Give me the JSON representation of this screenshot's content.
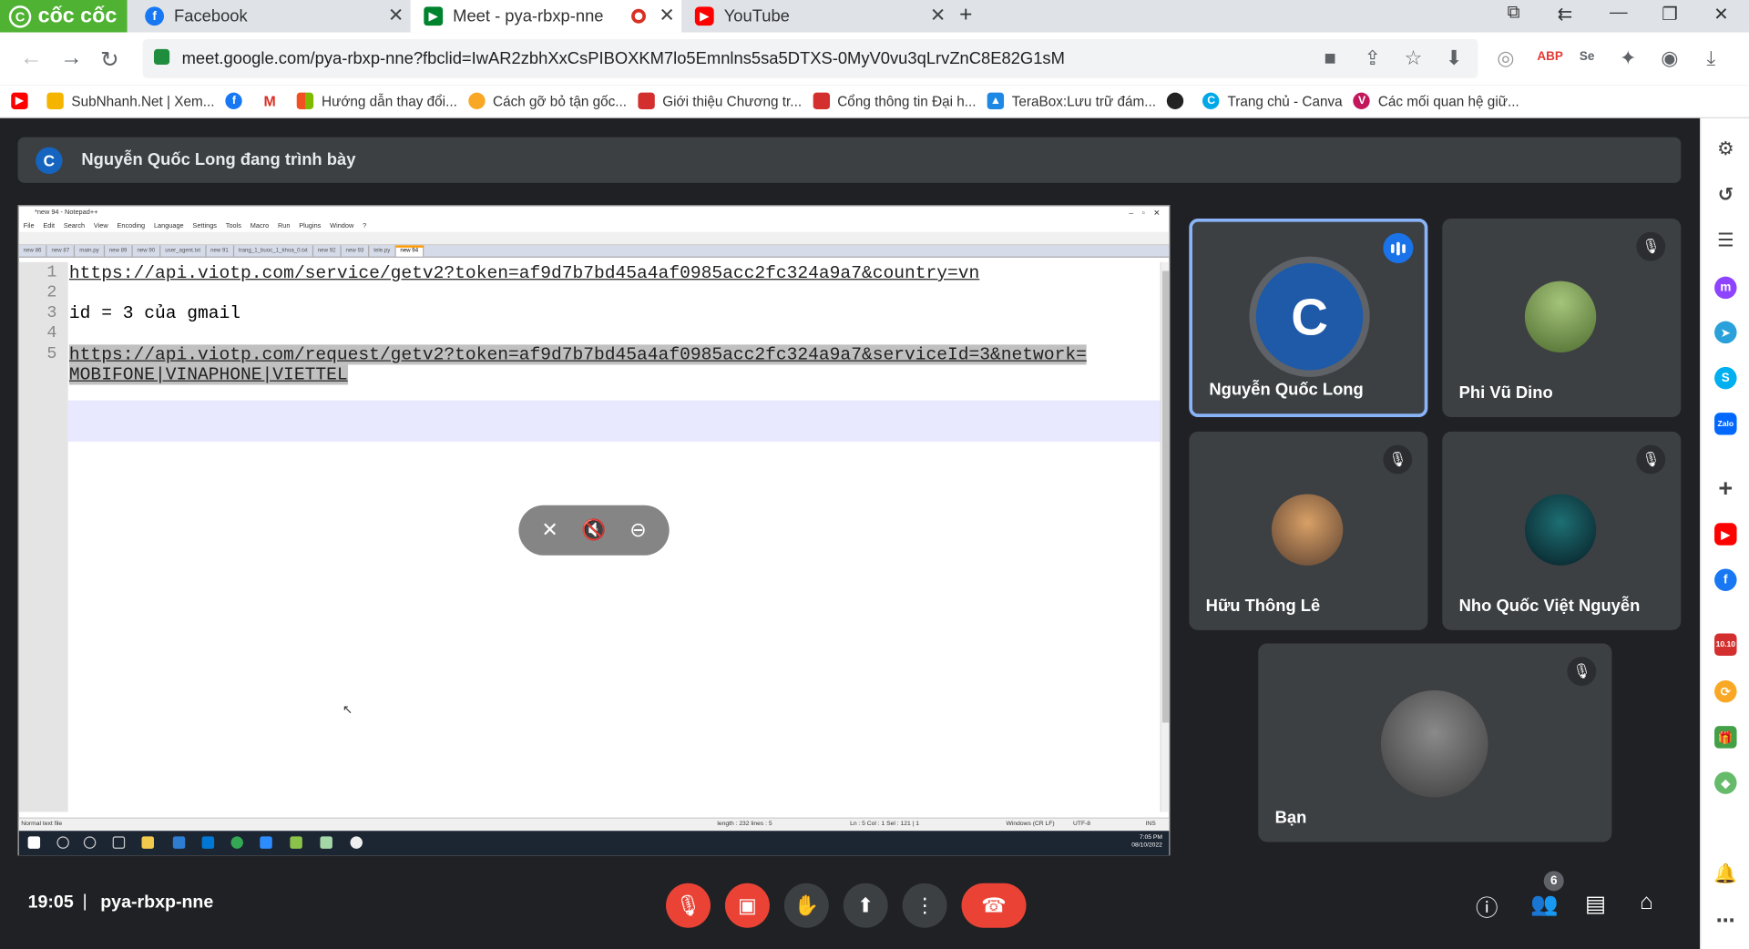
{
  "browser": {
    "brand": "cốc cốc",
    "tabs": [
      {
        "label": "Facebook"
      },
      {
        "label": "Meet - pya-rbxp-nne"
      },
      {
        "label": "YouTube"
      }
    ],
    "url": "meet.google.com/pya-rbxp-nne?fbclid=IwAR2zbhXxCsPIBOXKM7lo5Emnlns5sa5DTXS-0MyV0vu3qLrvZnC8E82G1sM",
    "bookmarks": [
      "SubNhanh.Net | Xem...",
      "Hướng dẫn thay đổi...",
      "Cách gỡ bỏ tận gốc...",
      "Giới thiệu Chương tr...",
      "Cổng thông tin Đại h...",
      "TeraBox:Lưu trữ đám...",
      "Trang chủ - Canva",
      "Các mối quan hệ giữ..."
    ]
  },
  "meet": {
    "banner": "Nguyễn Quốc Long đang trình bày",
    "time": "19:05",
    "meeting_code": "pya-rbxp-nne",
    "participant_count": "6",
    "participants": [
      {
        "name": "Nguyễn Quốc Long"
      },
      {
        "name": "Phi Vũ Dino"
      },
      {
        "name": "Hữu Thông Lê"
      },
      {
        "name": "Nho Quốc Việt Nguyễn"
      },
      {
        "name": "Bạn"
      }
    ]
  },
  "notepad": {
    "title": "*new 94 - Notepad++",
    "menu": [
      "File",
      "Edit",
      "Search",
      "View",
      "Encoding",
      "Language",
      "Settings",
      "Tools",
      "Macro",
      "Run",
      "Plugins",
      "Window",
      "?"
    ],
    "tabs": [
      "new 86",
      "new 87",
      "main.py",
      "new 89",
      "new 90",
      "user_agent.txt",
      "new 91",
      "trang_1_buoc_1_khoa_0.txt",
      "new 92",
      "new 93",
      "tele.py",
      "new 94"
    ],
    "lines": [
      {
        "n": "1",
        "text": "https://api.viotp.com/service/getv2?token=af9d7b7bd45a4af0985acc2fc324a9a7&country=vn"
      },
      {
        "n": "2",
        "text": ""
      },
      {
        "n": "3",
        "text": "id = 3 của gmail"
      },
      {
        "n": "4",
        "text": ""
      },
      {
        "n": "5",
        "text": "https://api.viotp.com/request/getv2?token=af9d7b7bd45a4af0985acc2fc324a9a7&serviceId=3&network="
      },
      {
        "n": "",
        "text": "MOBIFONE|VINAPHONE|VIETTEL"
      }
    ],
    "status": {
      "type": "Normal text file",
      "length": "length : 232    lines : 5",
      "position": "Ln : 5    Col : 1    Sel : 121 | 1",
      "eol": "Windows (CR LF)",
      "encoding": "UTF-8",
      "mode": "INS"
    },
    "taskbar_time": "7:05 PM",
    "taskbar_date": "08/10/2022"
  },
  "colors": {
    "brand_green": "#4fb233",
    "meet_bg": "#202124",
    "tile_bg": "#3c4043",
    "red": "#ea4335",
    "active_border": "#8ab4f8"
  }
}
